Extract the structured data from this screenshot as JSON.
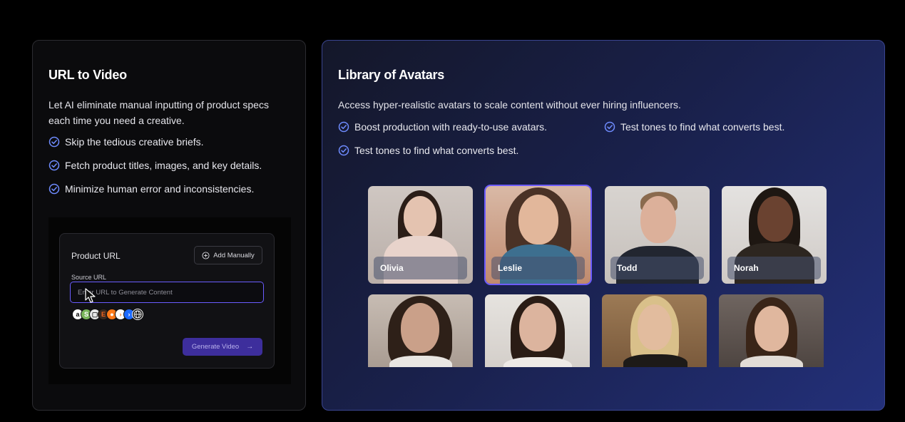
{
  "left_card": {
    "title": "URL to Video",
    "description": "Let AI eliminate manual inputting of product specs each time you need a creative.",
    "bullets": [
      "Skip the tedious creative briefs.",
      "Fetch product titles, images, and key details.",
      "Minimize human error and inconsistencies."
    ],
    "mockup": {
      "title": "Product URL",
      "add_manually_label": "Add Manually",
      "source_label": "Source URL",
      "url_placeholder": "Enter URL to Generate Content",
      "url_value": "",
      "generate_label": "Generate Video",
      "platform_icons": [
        "amazon-logo-icon",
        "shopify-logo-icon",
        "store-logo-icon",
        "etsy-logo-icon",
        "orange-logo-icon",
        "blue-logo-icon",
        "globe-icon"
      ]
    }
  },
  "right_card": {
    "title": "Library of Avatars",
    "description": "Access hyper-realistic avatars to scale content without ever hiring influencers.",
    "bullets": [
      "Boost production with ready-to-use avatars.",
      "Test tones to find what converts best.",
      "Test tones to find what converts best."
    ],
    "avatars": [
      {
        "name": "Olivia",
        "selected": false
      },
      {
        "name": "Leslie",
        "selected": true
      },
      {
        "name": "Todd",
        "selected": false
      },
      {
        "name": "Norah",
        "selected": false
      },
      {
        "name": "",
        "selected": false
      },
      {
        "name": "",
        "selected": false
      },
      {
        "name": "",
        "selected": false
      },
      {
        "name": "",
        "selected": false
      }
    ]
  },
  "colors": {
    "check_icon": "#6f8cff",
    "accent_border": "#6d5cff",
    "generate_button": "#3d2e9c"
  }
}
